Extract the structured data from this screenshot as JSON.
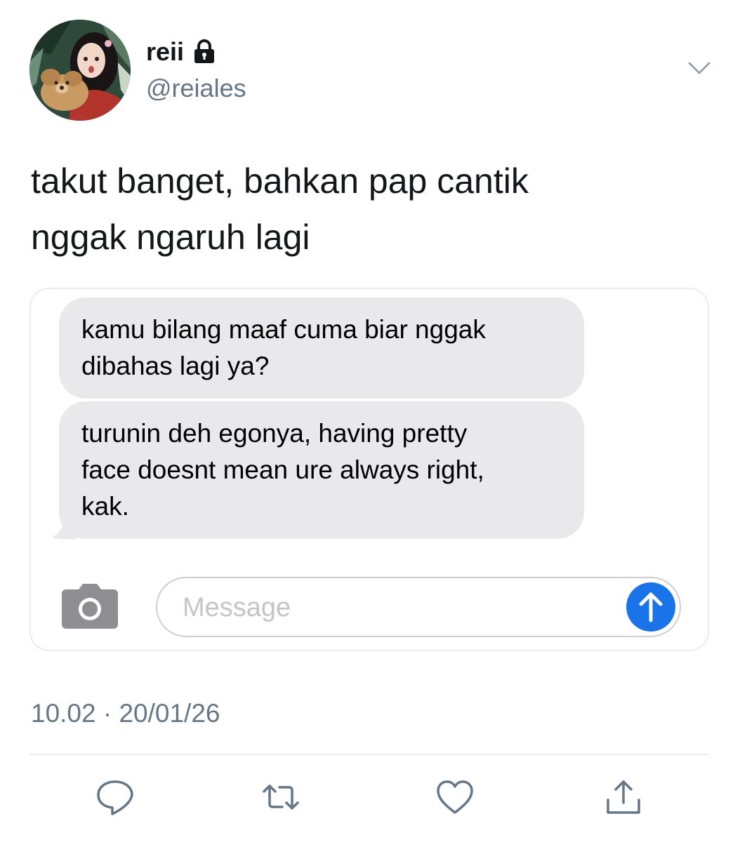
{
  "author": {
    "display_name": "reii",
    "handle": "@reiales",
    "protected_icon": "lock-icon"
  },
  "tweet": {
    "text": "takut banget, bahkan pap cantik\nnggak ngaruh lagi",
    "timestamp": "10.02 · 20/01/26"
  },
  "media": {
    "messages": [
      "kamu bilang maaf cuma biar nggak\ndibahas lagi ya?",
      "turunin deh egonya, having pretty\nface doesnt mean ure always right,\nkak."
    ],
    "input_placeholder": "Message",
    "camera_icon": "camera-icon",
    "send_icon": "send-arrow-icon",
    "bubble_color": "#e9e9eb",
    "send_color": "#1a73e8"
  },
  "actions": {
    "reply_icon": "reply-icon",
    "retweet_icon": "retweet-icon",
    "like_icon": "heart-icon",
    "share_icon": "share-icon",
    "icon_color": "#657786"
  },
  "colors": {
    "text_primary": "#14171a",
    "text_secondary": "#657786",
    "border": "#e6ecf0"
  }
}
